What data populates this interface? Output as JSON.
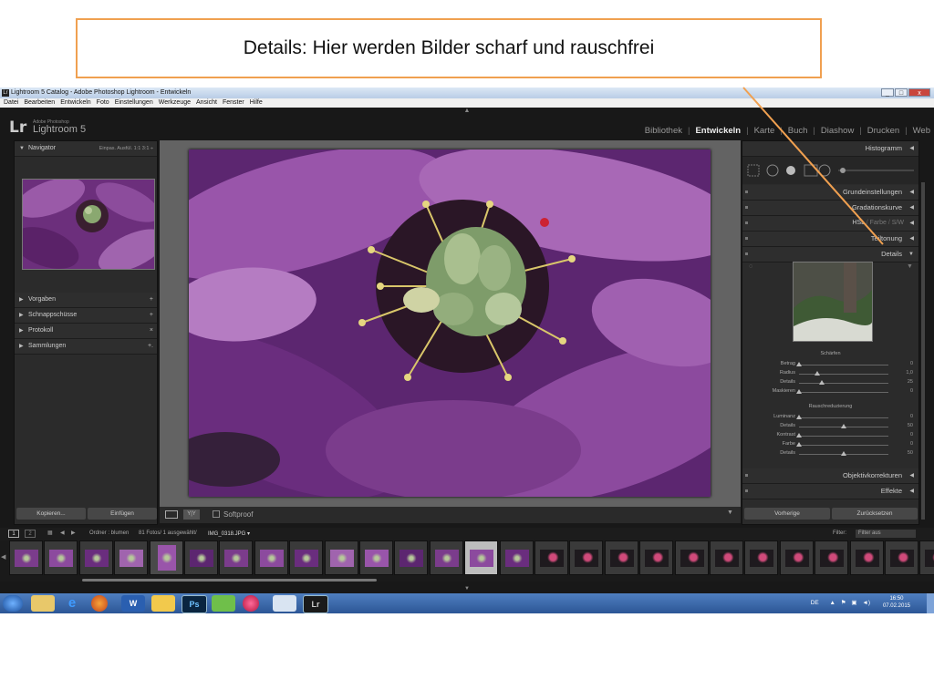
{
  "callout": {
    "text": "Details: Hier werden Bilder scharf und rauschfrei"
  },
  "window": {
    "title": "Lightroom 5 Catalog - Adobe Photoshop Lightroom - Entwickeln",
    "min": "_",
    "max": "□",
    "close": "x"
  },
  "menu": [
    "Datei",
    "Bearbeiten",
    "Entwickeln",
    "Foto",
    "Einstellungen",
    "Werkzeuge",
    "Ansicht",
    "Fenster",
    "Hilfe"
  ],
  "identity": {
    "logo": "Lr",
    "sub": "Adobe Photoshop",
    "name": "Lightroom 5"
  },
  "modules": [
    "Bibliothek",
    "Entwickeln",
    "Karte",
    "Buch",
    "Diashow",
    "Drucken",
    "Web"
  ],
  "left_panel": {
    "navigator": {
      "label": "Navigator",
      "options": "Einpas.  Ausfül.  1:1  3:1 ÷"
    },
    "sections": [
      {
        "label": "Vorgaben",
        "action": "+"
      },
      {
        "label": "Schnappschüsse",
        "action": "+"
      },
      {
        "label": "Protokoll",
        "action": "×"
      },
      {
        "label": "Sammlungen",
        "action": "+."
      }
    ],
    "copy_button": "Kopieren...",
    "paste_button": "Einfügen"
  },
  "toolbar": {
    "view_mode": "Y|Y",
    "softproof": "Softproof"
  },
  "right_panel": {
    "histogram": "Histogramm",
    "grundeinstellungen": "Grundeinstellungen",
    "gradationskurve": "Gradationskurve",
    "hsl": [
      "HSL",
      "Farbe",
      "S/W"
    ],
    "teiltonung": "Teiltonung",
    "details": "Details",
    "schaerfen": {
      "heading": "Schärfen",
      "sliders": [
        {
          "label": "Betrag",
          "value": "0",
          "pos": 0.0
        },
        {
          "label": "Radius",
          "value": "1,0",
          "pos": 0.2
        },
        {
          "label": "Details",
          "value": "25",
          "pos": 0.25
        },
        {
          "label": "Maskieren",
          "value": "0",
          "pos": 0.0
        }
      ]
    },
    "rausch": {
      "heading": "Rauschreduzierung",
      "sliders": [
        {
          "label": "Luminanz",
          "value": "0",
          "pos": 0.0
        },
        {
          "label": "Details",
          "value": "50",
          "pos": 0.5
        },
        {
          "label": "Kontrast",
          "value": "0",
          "pos": 0.0
        },
        {
          "label": "Farbe",
          "value": "0",
          "pos": 0.0
        },
        {
          "label": "Details",
          "value": "50",
          "pos": 0.5
        }
      ]
    },
    "objektivkorrekturen": "Objektivkorrekturen",
    "effekte": "Effekte",
    "prev_button": "Vorherige",
    "reset_button": "Zurücksetzen"
  },
  "filmbar": {
    "pages": [
      "1",
      "2"
    ],
    "path": "Ordner : blumen",
    "count": "81 Fotos/ 1 ausgewählt/",
    "file": "IMG_0318.JPG ▾",
    "filter_label": "Filter:",
    "filter_value": "Filter aus"
  },
  "taskbar": {
    "lang": "DE",
    "time": "16:50",
    "date": "07.02.2015",
    "apps": [
      "e",
      "Ps",
      "W",
      "Lr"
    ]
  },
  "colors": {
    "accent": "#f0a050",
    "purple": "#7b3c8c",
    "pistil": "#8aa870"
  }
}
